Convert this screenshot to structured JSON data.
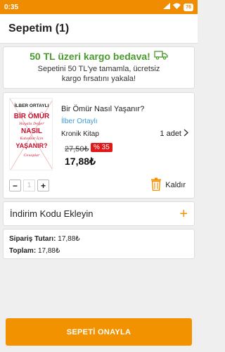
{
  "status": {
    "time": "0:35",
    "battery": "76"
  },
  "header": {
    "title": "Sepetim (1)"
  },
  "shipping": {
    "title": "50 TL üzeri kargo bedava!",
    "message_line1": "Sepetini 50 TL'ye tamamla, ücretsiz",
    "message_line2": "kargo fırsatını yakala!",
    "icon": "truck-icon"
  },
  "product": {
    "name": "Bir Ömür Nasıl Yaşanır?",
    "author": "İlber Ortaylı",
    "publisher": "Kronik Kitap",
    "quantity_text": "1 adet",
    "old_price": "27,50₺",
    "discount": "% 35",
    "price": "17,88₺",
    "stepper_value": "1",
    "remove_label": "Kaldır",
    "cover": {
      "author": "İLBER ORTAYLI",
      "line1": "BİR ÖMÜR",
      "line2": "Hayata Değer",
      "line3": "NASIL",
      "line4": "Katanlar İçin",
      "line5": "YAŞANIR?",
      "line6": "Cevaplar"
    }
  },
  "coupon": {
    "label": "İndirim Kodu Ekleyin"
  },
  "summary": {
    "order_total_label": "Sipariş Tutarı:",
    "order_total_value": "17,88₺",
    "total_label": "Toplam:",
    "total_value": "17,88₺"
  },
  "confirm": {
    "label": "SEPETİ ONAYLA"
  },
  "colors": {
    "accent": "#f39200",
    "green": "#4a9a2e",
    "discount": "#e01818",
    "link": "#3d9bd6"
  }
}
